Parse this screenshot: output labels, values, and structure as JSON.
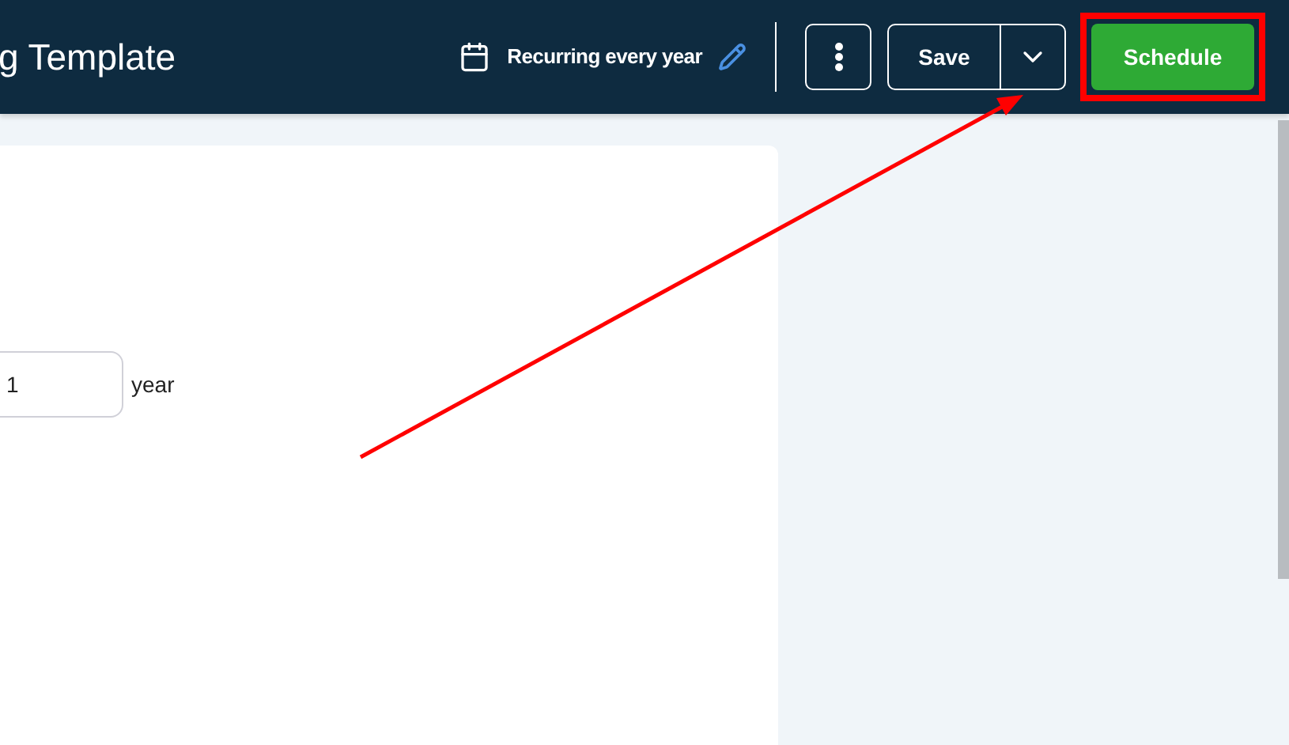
{
  "header": {
    "title": "g Template",
    "recurrence": "Recurring every year",
    "save": "Save",
    "schedule": "Schedule"
  },
  "form": {
    "interval": {
      "value": "1",
      "unit": "year"
    }
  },
  "annotation": {
    "highlight": true
  }
}
